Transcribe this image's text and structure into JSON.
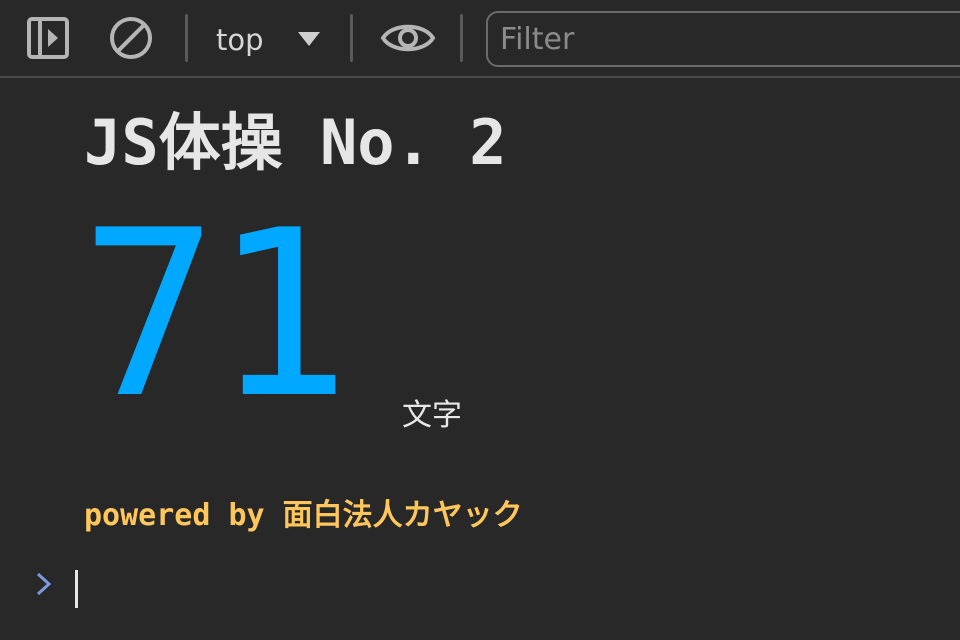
{
  "toolbar": {
    "icons": {
      "sidebar": "sidebar-toggle-icon",
      "clear": "clear-console-icon",
      "context_caret": "caret-down-icon",
      "live_expression": "eye-icon"
    },
    "context_label": "top",
    "filter_placeholder": "Filter",
    "filter_value": ""
  },
  "console": {
    "heading": "JS体操 No. 2",
    "count_value": "71",
    "count_unit": "文字",
    "powered_by": "powered by 面白法人カヤック",
    "prompt_icon": "chevron-right-icon"
  },
  "colors": {
    "background": "#282828",
    "heading": "#e6e6e6",
    "count": "#00a8ff",
    "powered_by": "#ffc65c",
    "prompt_chevron": "#7a9bdf"
  }
}
